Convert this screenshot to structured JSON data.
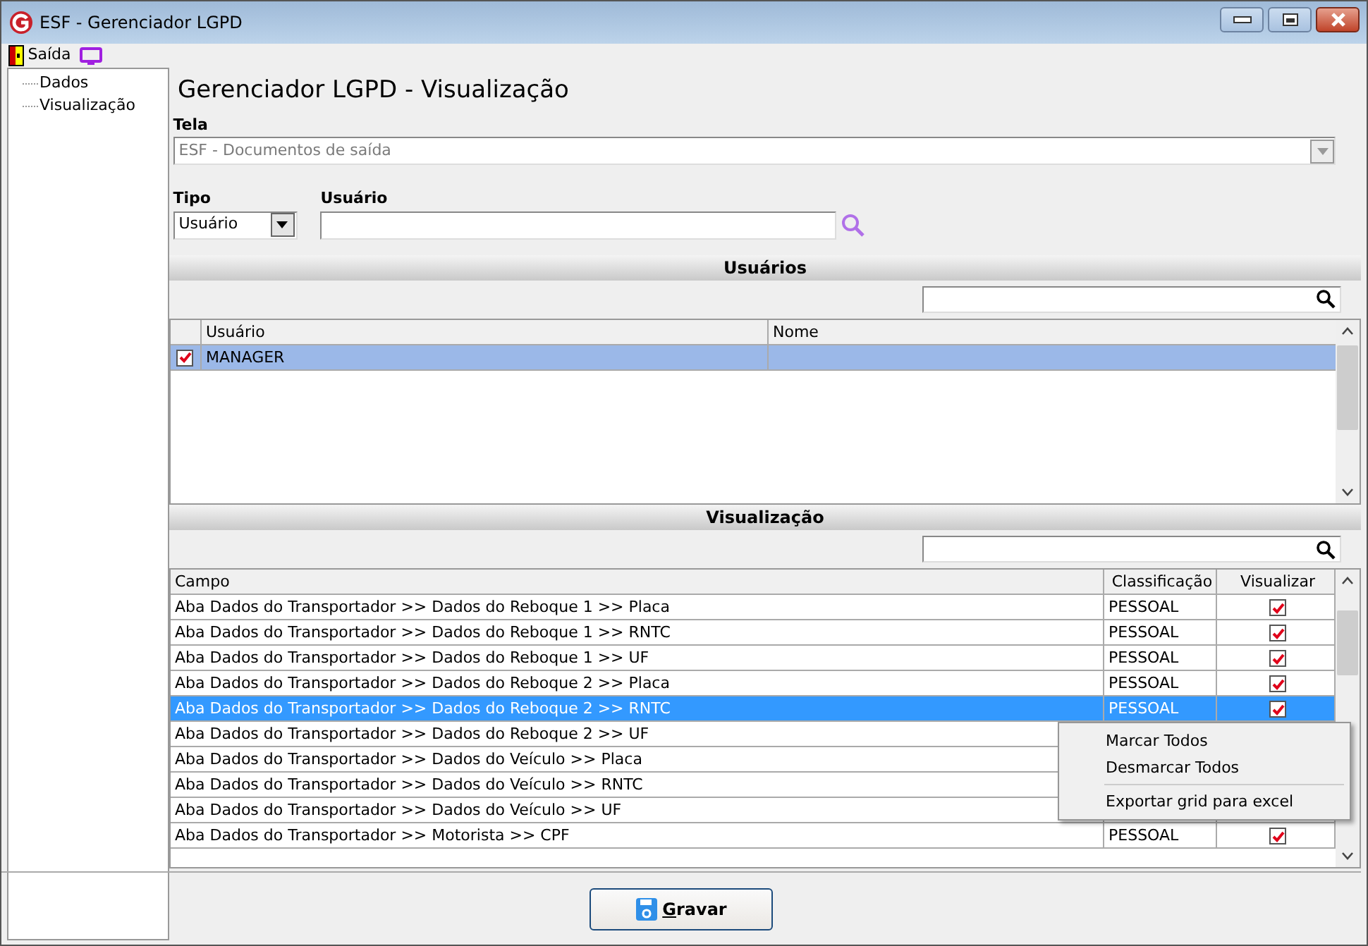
{
  "window": {
    "title": "ESF - Gerenciador LGPD"
  },
  "menu": [
    {
      "label": "Saída"
    }
  ],
  "tree": [
    {
      "label": "Dados"
    },
    {
      "label": "Visualização"
    }
  ],
  "heading": "Gerenciador LGPD - Visualização",
  "tela": {
    "label": "Tela",
    "value": "ESF - Documentos de saída",
    "disabled": true
  },
  "tipo": {
    "label": "Tipo",
    "value": "Usuário"
  },
  "usuario": {
    "label": "Usuário"
  },
  "usuarios_section": {
    "title": "Usuários",
    "columns": [
      "Usuário",
      "Nome"
    ],
    "rows": [
      {
        "checked": true,
        "selected": true,
        "usuario": "MANAGER"
      }
    ]
  },
  "visualizacao_section": {
    "title": "Visualização",
    "columns": [
      "Campo",
      "Classificação",
      "Visualizar"
    ],
    "rows": [
      {
        "campo": "Aba Dados do Transportador >> Dados do Reboque 1 >> Placa",
        "classificacao": "PESSOAL",
        "visualizar": true,
        "selected": false
      },
      {
        "campo": "Aba Dados do Transportador >> Dados do Reboque 1 >> RNTC",
        "classificacao": "PESSOAL",
        "visualizar": true,
        "selected": false
      },
      {
        "campo": "Aba Dados do Transportador >> Dados do Reboque 1 >> UF",
        "classificacao": "PESSOAL",
        "visualizar": true,
        "selected": false
      },
      {
        "campo": "Aba Dados do Transportador >> Dados do Reboque 2 >> Placa",
        "classificacao": "PESSOAL",
        "visualizar": true,
        "selected": false
      },
      {
        "campo": "Aba Dados do Transportador >> Dados do Reboque 2 >> RNTC",
        "classificacao": "PESSOAL",
        "visualizar": true,
        "selected": true
      },
      {
        "campo": "Aba Dados do Transportador >> Dados do Reboque 2 >> UF",
        "selected": false
      },
      {
        "campo": "Aba Dados do Transportador >> Dados do Veículo >> Placa",
        "selected": false
      },
      {
        "campo": "Aba Dados do Transportador >> Dados do Veículo >> RNTC",
        "selected": false
      },
      {
        "campo": "Aba Dados do Transportador >> Dados do Veículo >> UF",
        "selected": false
      },
      {
        "campo": "Aba Dados do Transportador >> Motorista >> CPF",
        "classificacao": "PESSOAL",
        "visualizar": true,
        "selected": false
      }
    ]
  },
  "context_menu": [
    {
      "label": "Marcar Todos",
      "kind": "item"
    },
    {
      "label": "Desmarcar Todos",
      "kind": "item"
    },
    {
      "kind": "separator"
    },
    {
      "label": "Exportar grid para excel",
      "kind": "item"
    }
  ],
  "save_button": {
    "label": "Gravar"
  }
}
